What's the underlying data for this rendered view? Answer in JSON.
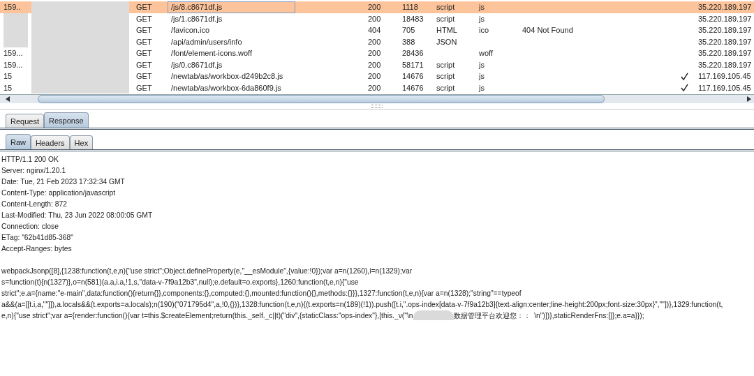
{
  "history_table": {
    "rows": [
      {
        "number": "159..",
        "method": "GET",
        "url": "/js/8.c8671df.js",
        "status": "200",
        "length": "1118",
        "mime": "script",
        "extension": "js",
        "ssl": false,
        "ip": "35.220.189.197",
        "selected": true
      },
      {
        "method": "GET",
        "url": "/js/1.c8671df.js",
        "status": "200",
        "length": "18483",
        "mime": "script",
        "extension": "js",
        "ssl": false,
        "ip": "35.220.189.197",
        "selected": false
      },
      {
        "method": "GET",
        "url": "/favicon.ico",
        "status": "404",
        "length": "705",
        "mime": "HTML",
        "extension": "ico",
        "title": "404 Not Found",
        "ssl": false,
        "ip": "35.220.189.197",
        "selected": false
      },
      {
        "method": "GET",
        "url": "/api/admin/users/info",
        "status": "200",
        "length": "388",
        "mime": "JSON",
        "ssl": false,
        "ip": "35.220.189.197",
        "selected": false
      },
      {
        "number": "159...",
        "method": "GET",
        "url": "/font/element-icons.woff",
        "status": "200",
        "length": "28436",
        "extension": "woff",
        "ssl": false,
        "ip": "35.220.189.197",
        "selected": false
      },
      {
        "number": "159...",
        "method": "GET",
        "url": "/js/0.c8671df.js",
        "status": "200",
        "length": "58171",
        "mime": "script",
        "extension": "js",
        "ssl": false,
        "ip": "35.220.189.197",
        "selected": false
      },
      {
        "number": "15",
        "method": "GET",
        "url": "/newtab/as/workbox-d249b2c8.js",
        "status": "200",
        "length": "14676",
        "mime": "script",
        "extension": "js",
        "ssl": true,
        "ip": "117.169.105.45",
        "selected": false
      },
      {
        "number": "15",
        "method": "GET",
        "url": "/newtab/as/workbox-6da860f9.js",
        "status": "200",
        "length": "14676",
        "mime": "script",
        "extension": "js",
        "ssl": true,
        "ip": "117.169.105.45",
        "selected": false
      }
    ]
  },
  "message_tabs": [
    {
      "label": "Request",
      "selected": false
    },
    {
      "label": "Response",
      "selected": true
    }
  ],
  "view_tabs": [
    {
      "label": "Raw",
      "selected": true
    },
    {
      "label": "Headers",
      "selected": false
    },
    {
      "label": "Hex",
      "selected": false
    }
  ],
  "response": {
    "headers": [
      "HTTP/1.1 200 OK",
      "Server: nginx/1.20.1",
      "Date: Tue, 21 Feb 2023 17:32:34 GMT",
      "Content-Type: application/javascript",
      "Content-Length: 872",
      "Last-Modified: Thu, 23 Jun 2022 08:00:05 GMT",
      "Connection: close",
      "ETag: \"62b41d85-368\"",
      "Accept-Ranges: bytes"
    ],
    "body_lines": [
      {
        "segments": [
          "webpackJsonp([8],{1238:function(t,e,n){\"use strict\";Object.defineProperty(e,\"__esModule\",{value:!0});var a=n(1260),i=n(1329);var"
        ]
      },
      {
        "segments": [
          "s=function(t){n(1327)},o=n(581)(a.a,i.a,!1,s,\"data-v-7f9a12b3\",null);e.default=o.exports},1260:function(t,e,n){\"use"
        ]
      },
      {
        "segments": [
          "strict\";e.a={name:\"e-main\",data:function(){return{}},components:{},computed:{},mounted:function(){},methods:{}}},1327:function(t,e,n){var a=n(1328);\"string\"==typeof"
        ]
      },
      {
        "segments": [
          "a&&(a=[[t.i,a,\"\"]]),a.locals&&(t.exports=a.locals);n(190)(\"071795d4\",a,!0,{})},1328:function(t,e,n){(t.exports=n(189)(!1)).push([t.i,\".ops-index[data-v-7f9a12b3]{text-align:center;line-height:200px;font-size:30px}\",\"\"])},1329:function(t,"
        ]
      },
      {
        "segments": [
          "e,n){\"use strict\";var a={render:function(){var t=this.$createElement;return(this._self._c||t)(\"div\",{staticClass:\"ops-index\"},[this._v(\"\\n",
          "数据管理平台欢迎您：：  \\n\")])},staticRenderFns:[]};e.a=a}});"
        ]
      }
    ]
  }
}
